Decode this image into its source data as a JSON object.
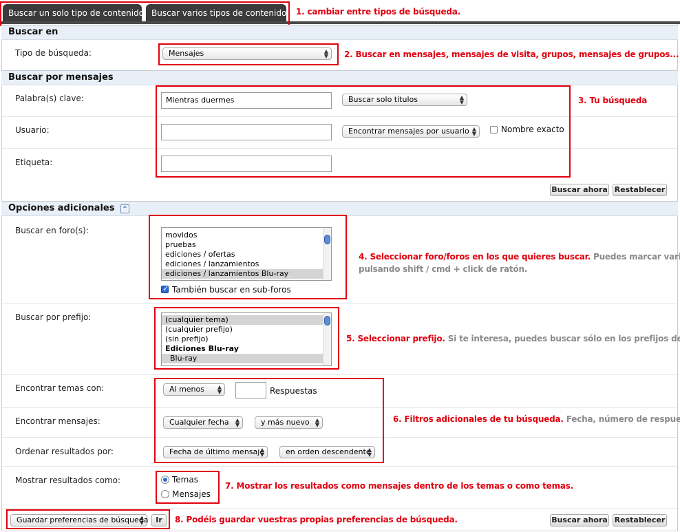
{
  "tabs": [
    {
      "label": "Buscar un solo tipo de contenido"
    },
    {
      "label": "Buscar varios tipos de contenido"
    }
  ],
  "notes": {
    "n1": "1. cambiar entre tipos de búsqueda.",
    "n2": "2. Buscar en mensajes, mensajes de visita, grupos, mensajes de grupos...",
    "n3": "3. Tu búsqueda",
    "n4_red": "4. Seleccionar foro/foros en los que quieres buscar.",
    "n4_gray_a": "Puedes marcar varios",
    "n4_gray_b": "pulsando shift / cmd  + click de ratón.",
    "n5_red": "5. Seleccionar prefijo.",
    "n5_gray": "Si te interesa, puedes buscar sólo en los prefijos definidos",
    "n6_red": "6. Filtros adicionales de tu búsqueda.",
    "n6_gray": "Fecha, número de respuestas...",
    "n7": "7. Mostrar los resultados como mensajes dentro de los temas o como temas.",
    "n8": "8. Podéis guardar vuestras propias preferencias de búsqueda."
  },
  "buscar_en": {
    "heading": "Buscar en",
    "tipo_label": "Tipo de búsqueda:",
    "tipo_value": "Mensajes"
  },
  "buscar_mensajes": {
    "heading": "Buscar por mensajes",
    "keywords_label": "Palabra(s) clave:",
    "keywords_value": "Mientras duermes",
    "keywords_mode": "Buscar solo títulos",
    "user_label": "Usuario:",
    "user_value": "",
    "user_mode": "Encontrar mensajes por usuario",
    "exact_name": "Nombre exacto",
    "tag_label": "Etiqueta:",
    "tag_value": ""
  },
  "buttons": {
    "search": "Buscar ahora",
    "reset": "Restablecer",
    "go": "Ir"
  },
  "opciones": {
    "heading": "Opciones adicionales",
    "collapse_glyph": "⌃",
    "forums_label": "Buscar en foro(s):",
    "forums": [
      "movidos",
      "pruebas",
      "ediciones / ofertas",
      "ediciones / lanzamientos",
      "ediciones / lanzamientos Blu-ray"
    ],
    "subforums": "También buscar en sub-foros",
    "prefix_label": "Buscar por prefijo:",
    "prefixes": [
      "(cualquier tema)",
      "(cualquier prefijo)",
      "(sin prefijo)",
      "Ediciones Blu-ray",
      "Blu-ray"
    ],
    "threads_label": "Encontrar temas con:",
    "threads_mode": "Al menos",
    "threads_count": "",
    "replies": "Respuestas",
    "messages_label": "Encontrar mensajes:",
    "date_mode": "Cualquier fecha",
    "date_dir": "y más nuevo",
    "order_label": "Ordenar resultados por:",
    "order_by": "Fecha de último mensaje",
    "order_dir": "en orden descendente",
    "show_label": "Mostrar resultados como:",
    "show_topics": "Temas",
    "show_posts": "Mensajes",
    "prefs": "Guardar preferencias de búsqueda"
  }
}
